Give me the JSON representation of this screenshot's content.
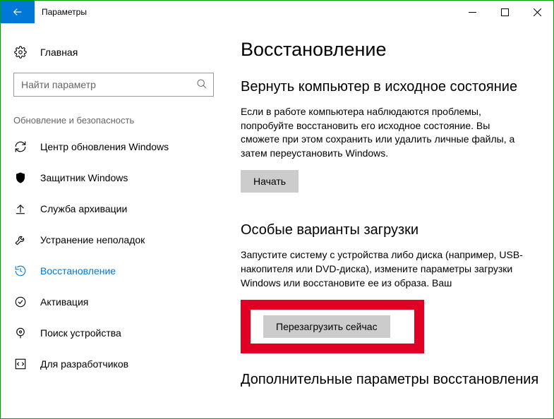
{
  "titlebar": {
    "title": "Параметры"
  },
  "sidebar": {
    "home": "Главная",
    "search_placeholder": "Найти параметр",
    "section": "Обновление и безопасность",
    "items": [
      {
        "label": "Центр обновления Windows"
      },
      {
        "label": "Защитник Windows"
      },
      {
        "label": "Служба архивации"
      },
      {
        "label": "Устранение неполадок"
      },
      {
        "label": "Восстановление"
      },
      {
        "label": "Активация"
      },
      {
        "label": "Поиск устройства"
      },
      {
        "label": "Для разработчиков"
      }
    ]
  },
  "main": {
    "title": "Восстановление",
    "reset": {
      "heading": "Вернуть компьютер в исходное состояние",
      "body": "Если в работе компьютера наблюдаются проблемы, попробуйте восстановить его исходное состояние. Вы сможете при этом сохранить или удалить личные файлы, а затем переустановить Windows.",
      "button": "Начать"
    },
    "advanced": {
      "heading": "Особые варианты загрузки",
      "body": "Запустите систему с устройства либо диска (например, USB-накопителя или DVD-диска), измените параметры загрузки Windows или восстановите ее из образа. Ваш",
      "button": "Перезагрузить сейчас"
    },
    "more": {
      "heading": "Дополнительные параметры восстановления"
    }
  }
}
